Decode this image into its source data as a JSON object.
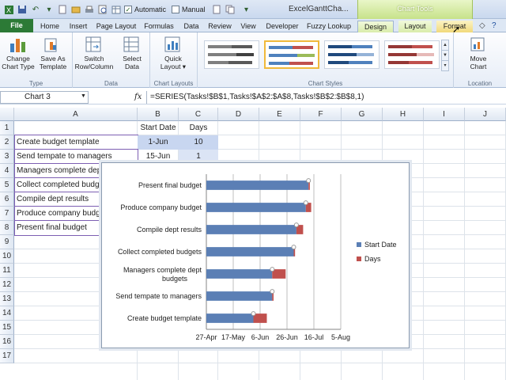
{
  "quick_access": {
    "automatic_label": "Automatic",
    "manual_label": "Manual",
    "automatic_checked": true,
    "manual_checked": false
  },
  "window": {
    "title": "ExcelGanttCha..."
  },
  "context_tab": {
    "label": "Chart Tools",
    "color": "#c7e28a"
  },
  "tabs": [
    {
      "label": "File"
    },
    {
      "label": "Home"
    },
    {
      "label": "Insert"
    },
    {
      "label": "Page Layout"
    },
    {
      "label": "Formulas"
    },
    {
      "label": "Data"
    },
    {
      "label": "Review"
    },
    {
      "label": "View"
    },
    {
      "label": "Developer"
    },
    {
      "label": "Fuzzy Lookup"
    },
    {
      "label": "Design"
    },
    {
      "label": "Layout"
    },
    {
      "label": "Format"
    }
  ],
  "ribbon": {
    "type_group": {
      "label": "Type",
      "change_chart_type": "Change\nChart Type",
      "save_as_template": "Save As\nTemplate"
    },
    "data_group": {
      "label": "Data",
      "switch_row_column": "Switch\nRow/Column",
      "select_data": "Select\nData"
    },
    "layouts_group": {
      "label": "Chart Layouts",
      "quick_layout": "Quick\nLayout ▾"
    },
    "styles_group": {
      "label": "Chart Styles"
    },
    "location_group": {
      "label": "Location",
      "move_chart": "Move\nChart"
    }
  },
  "formula_bar": {
    "name_box": "Chart 3",
    "fx": "fx",
    "formula": "=SERIES(Tasks!$B$1,Tasks!$A$2:$A$8,Tasks!$B$2:$B$8,1)"
  },
  "columns": [
    "A",
    "B",
    "C",
    "D",
    "E",
    "F",
    "G",
    "H",
    "I",
    "J"
  ],
  "rows": [
    "1",
    "2",
    "3",
    "4",
    "5",
    "6",
    "7",
    "8",
    "9",
    "10",
    "11",
    "12",
    "13",
    "14",
    "15",
    "16",
    "17"
  ],
  "cells": {
    "B1": "Start Date",
    "C1": "Days",
    "A2": "Create budget template",
    "B2": "1-Jun",
    "C2": "10",
    "A3": "Send tempate to managers",
    "B3": "15-Jun",
    "C3": "1",
    "A4": "Managers complete dept budgets",
    "A5": "Collect completed budgets",
    "A6": "Compile dept results",
    "A7": "Produce company budget",
    "A8": "Present final budget"
  },
  "chart_data": {
    "type": "bar",
    "orientation": "horizontal",
    "stacked": true,
    "categories": [
      "Create budget template",
      "Send tempate to managers",
      "Managers complete dept budgets",
      "Collect completed budgets",
      "Compile dept results",
      "Produce company budget",
      "Present final budget"
    ],
    "series": [
      {
        "name": "Start Date",
        "color": "#5b7fb5",
        "values": [
          "2011-06-01",
          "2011-06-15",
          "2011-06-15",
          "2011-07-01",
          "2011-07-03",
          "2011-07-10",
          "2011-07-12"
        ]
      },
      {
        "name": "Days",
        "color": "#c0504d",
        "values": [
          10,
          1,
          10,
          1,
          5,
          4,
          1
        ]
      }
    ],
    "x_ticks": [
      "27-Apr",
      "17-May",
      "6-Jun",
      "26-Jun",
      "16-Jul",
      "5-Aug"
    ],
    "xlim": [
      "2011-04-27",
      "2011-08-05"
    ],
    "legend": "right",
    "grid": "vertical"
  }
}
